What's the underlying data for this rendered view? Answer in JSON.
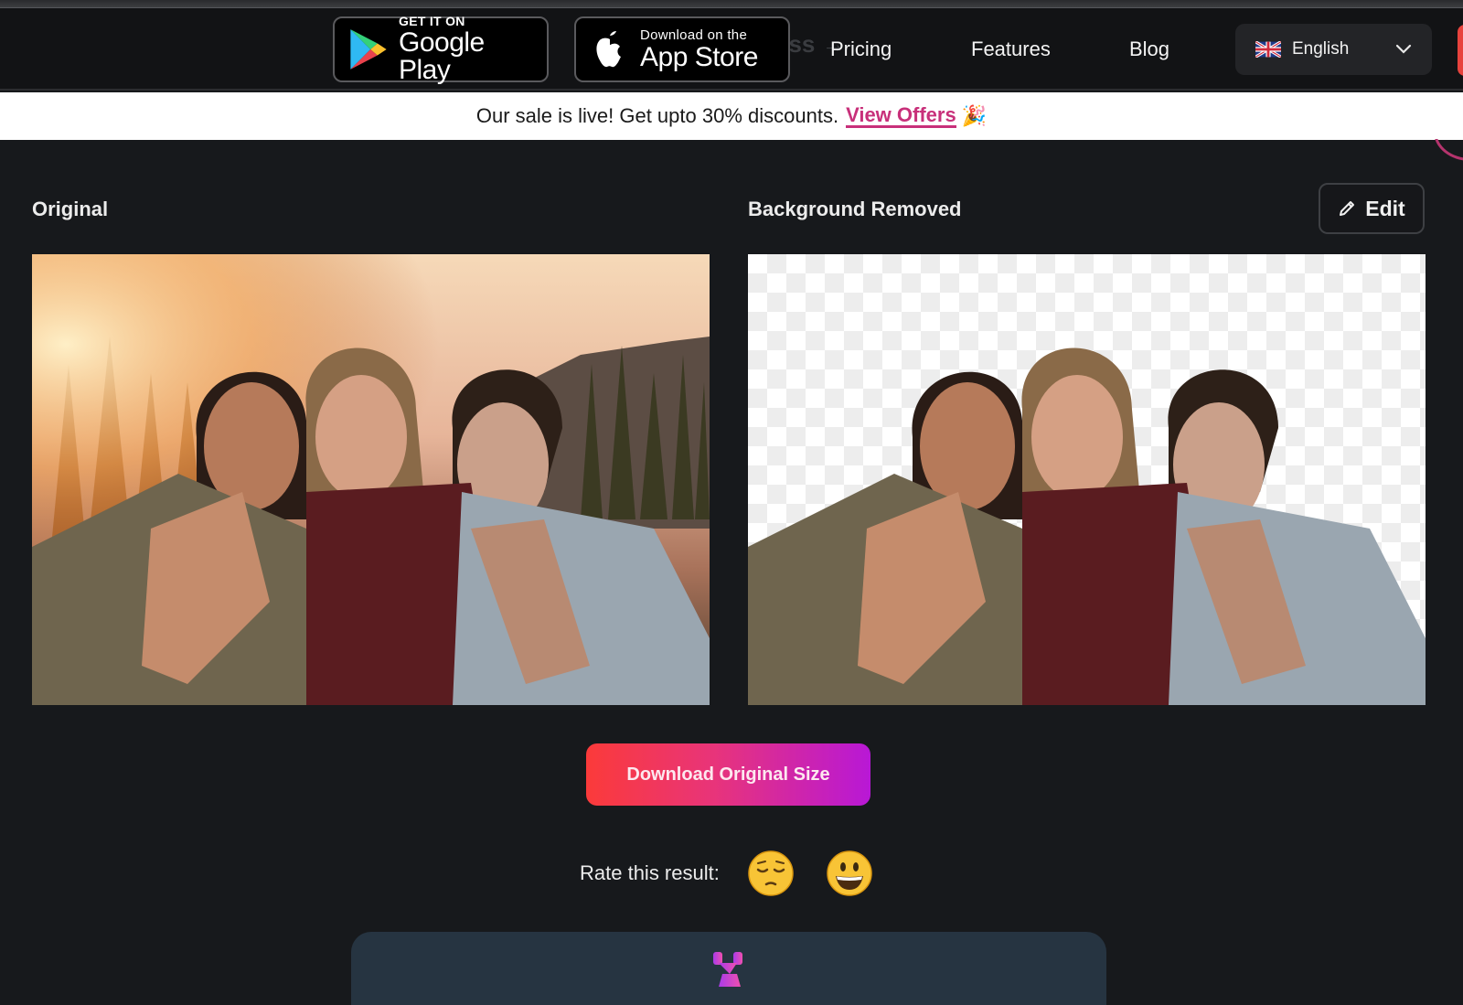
{
  "navbar": {
    "ghost_text": "ess →",
    "google_play": {
      "small": "GET IT ON",
      "big": "Google Play"
    },
    "app_store": {
      "small": "Download on the",
      "big": "App Store"
    },
    "links": [
      {
        "label": "Pricing"
      },
      {
        "label": "Features"
      },
      {
        "label": "Blog"
      }
    ],
    "language": {
      "selected": "English",
      "flag": "uk-flag-icon"
    }
  },
  "promo": {
    "text": "Our sale is live! Get upto 30% discounts.",
    "link": "View Offers",
    "emoji": "🎉",
    "link_color": "#c8307a"
  },
  "panels": {
    "original": {
      "title": "Original"
    },
    "removed": {
      "title": "Background Removed",
      "edit_label": "Edit"
    }
  },
  "actions": {
    "download_label": "Download Original Size",
    "gradient": [
      "#fb3a3a",
      "#e8347a",
      "#b818d6"
    ]
  },
  "rating": {
    "label": "Rate this result:",
    "options": [
      {
        "name": "pensive-face",
        "meaning": "bad"
      },
      {
        "name": "grinning-face",
        "meaning": "good"
      }
    ]
  }
}
